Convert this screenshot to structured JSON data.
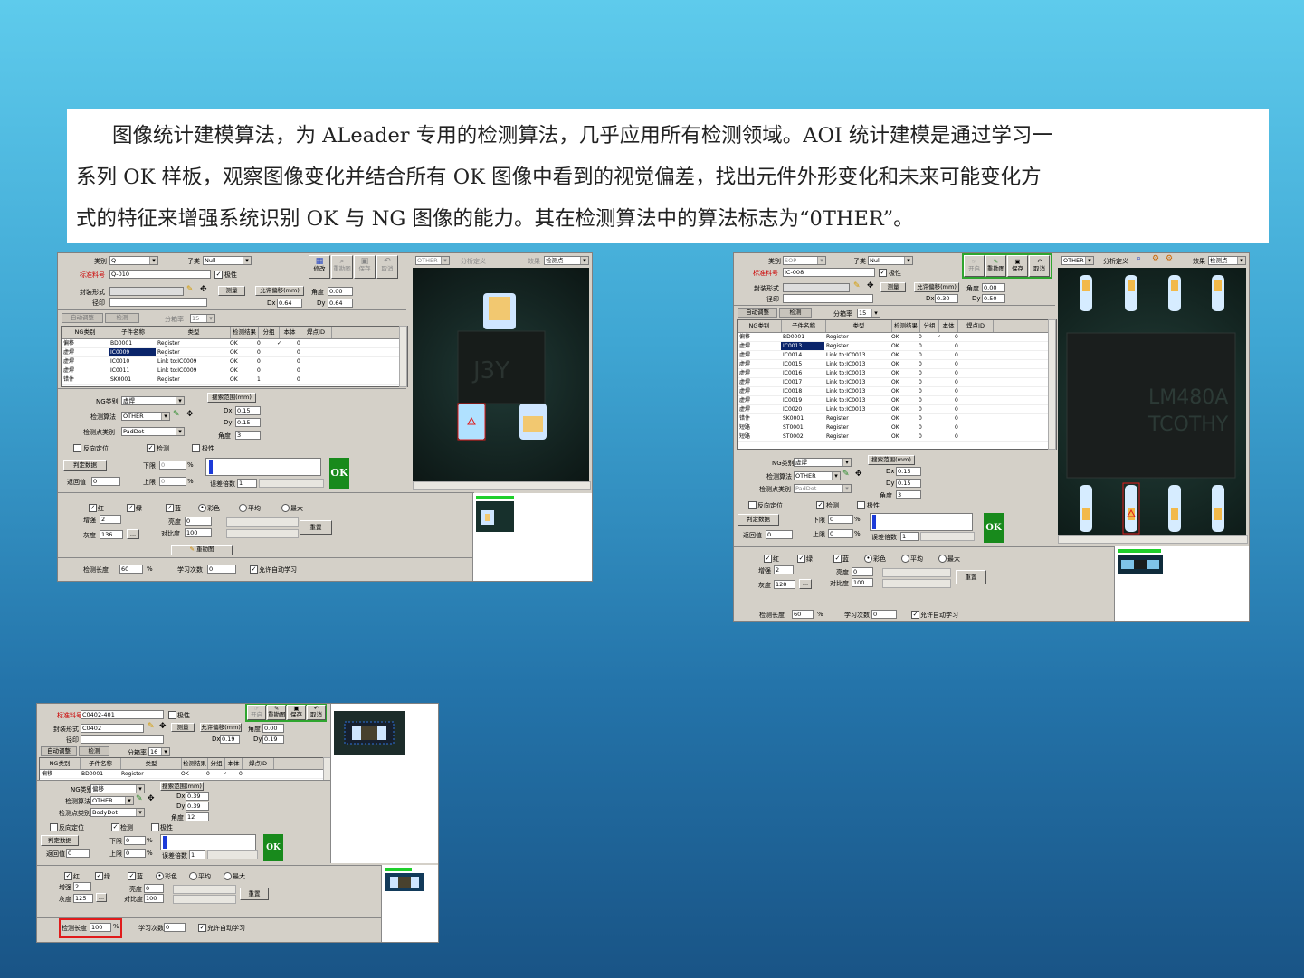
{
  "intro": {
    "line1": "图像统计建模算法，为 ALeader 专用的检测算法，几乎应用所有检测领域。AOI 统计建模是通过学习一",
    "line2": "系列 OK 样板，观察图像变化并结合所有 OK 图像中看到的视觉偏差，找出元件外形变化和未来可能变化方",
    "line3": "式的特征来增强系统识别 OK 与 NG 图像的能力。其在检测算法中的算法标志为“0THER”。"
  },
  "labels": {
    "category": "类别",
    "subcategory": "子类",
    "subcat_value": "Null",
    "std_part": "标准料号",
    "polarity": "极性",
    "package": "封装形式",
    "diameter": "径印",
    "measure": "测量",
    "offset_allowed": "允许偏移(mm)",
    "angle": "角度",
    "dx": "Dx",
    "dy": "Dy",
    "auto_adjust": "自动调整",
    "inspect": "检测",
    "group_num": "分箱率",
    "ng_type": "NG类别",
    "algo": "检测算法",
    "pad_type": "检测点类别",
    "search_range": "搜索范围(mm)",
    "reverse_pos": "反向定位",
    "judge_data": "判定数据",
    "lower": "下限",
    "upper": "上限",
    "return_val": "返回值",
    "err_mult": "误差倍数",
    "ok": "OK",
    "red": "红",
    "green": "绿",
    "blue": "蓝",
    "color": "彩色",
    "average": "平均",
    "max": "最大",
    "gain": "增强",
    "gray": "灰度",
    "brightness": "亮度",
    "contrast": "对比度",
    "reset": "重置",
    "redraw": "重勘图",
    "inspect_len": "检测长度",
    "learn_count": "学习次数",
    "auto_learn": "允许自动学习",
    "modify": "修改",
    "save": "保存",
    "cancel": "取消",
    "start": "开启",
    "analysis_def": "分析定义",
    "effect": "效果",
    "inspect_point": "检测点",
    "pct": "%",
    "dots": "...",
    "other": "OTHER",
    "null_bar": "Null"
  },
  "panel1": {
    "category_val": "Q",
    "part_no": "Q-010",
    "dx": "0.64",
    "dy": "0.64",
    "angle": "0.00",
    "group": "15",
    "columns": [
      "NG类别",
      "子件名称",
      "类型",
      "检测结果",
      "分组",
      "本体",
      "焊点ID"
    ],
    "rows": [
      [
        "偏移",
        "BD0001",
        "Register",
        "OK",
        "0",
        "✓",
        "0"
      ],
      [
        "虚焊",
        "IC0009",
        "Register",
        "OK",
        "0",
        "",
        "0"
      ],
      [
        "虚焊",
        "IC0010",
        "Link to:IC0009",
        "OK",
        "0",
        "",
        "0"
      ],
      [
        "虚焊",
        "IC0011",
        "Link to:IC0009",
        "OK",
        "0",
        "",
        "0"
      ],
      [
        "错件",
        "SK0001",
        "Register",
        "OK",
        "1",
        "",
        "0"
      ]
    ],
    "ng_val": "虚焊",
    "pad_val": "PadDot",
    "search_dx": "0.15",
    "search_dy": "0.15",
    "search_angle": "3",
    "lower": "0",
    "upper": "0",
    "return_val": "0",
    "err_mult": "1",
    "gain": "2",
    "gray": "136",
    "brightness": "0",
    "contrast": "100",
    "len": "60",
    "learn": "0"
  },
  "panel2": {
    "category_val": "SOP",
    "part_no": "IC-008",
    "dx": "0.30",
    "dy": "0.50",
    "angle": "0.00",
    "group": "15",
    "rows": [
      [
        "偏移",
        "BD0001",
        "Register",
        "OK",
        "0",
        "✓",
        "0"
      ],
      [
        "虚焊",
        "IC0013",
        "Register",
        "OK",
        "0",
        "",
        "0"
      ],
      [
        "虚焊",
        "IC0014",
        "Link to:IC0013",
        "OK",
        "0",
        "",
        "0"
      ],
      [
        "虚焊",
        "IC0015",
        "Link to:IC0013",
        "OK",
        "0",
        "",
        "0"
      ],
      [
        "虚焊",
        "IC0016",
        "Link to:IC0013",
        "OK",
        "0",
        "",
        "0"
      ],
      [
        "虚焊",
        "IC0017",
        "Link to:IC0013",
        "OK",
        "0",
        "",
        "0"
      ],
      [
        "虚焊",
        "IC0018",
        "Link to:IC0013",
        "OK",
        "0",
        "",
        "0"
      ],
      [
        "虚焊",
        "IC0019",
        "Link to:IC0013",
        "OK",
        "0",
        "",
        "0"
      ],
      [
        "虚焊",
        "IC0020",
        "Link to:IC0013",
        "OK",
        "0",
        "",
        "0"
      ],
      [
        "错件",
        "SK0001",
        "Register",
        "OK",
        "0",
        "",
        "0"
      ],
      [
        "短路",
        "ST0001",
        "Register",
        "OK",
        "0",
        "",
        "0"
      ],
      [
        "短路",
        "ST0002",
        "Register",
        "OK",
        "0",
        "",
        "0"
      ]
    ],
    "ng_val": "虚焊",
    "pad_val": "PadDot",
    "search_dx": "0.15",
    "search_dy": "0.15",
    "search_angle": "3",
    "lower": "0",
    "upper": "0",
    "return_val": "0",
    "err_mult": "1",
    "gain": "2",
    "gray": "128",
    "brightness": "0",
    "contrast": "100",
    "len": "60",
    "learn": "0"
  },
  "panel3": {
    "part_no": "C0402-401",
    "package": "C0402",
    "dx": "0.19",
    "dy": "0.19",
    "angle": "0.00",
    "group": "16",
    "rows": [
      [
        "偏移",
        "BD0001",
        "Register",
        "OK",
        "0",
        "✓",
        "0"
      ]
    ],
    "ng_val": "偏移",
    "pad_val": "BodyDot",
    "search_dx": "0.39",
    "search_dy": "0.39",
    "search_angle": "12",
    "lower": "0",
    "upper": "0",
    "return_val": "0",
    "err_mult": "1",
    "gain": "2",
    "gray": "125",
    "brightness": "0",
    "contrast": "100",
    "len": "100",
    "learn": "0"
  },
  "colors": {
    "ok_green": "#188a1c",
    "highlight_red": "#e01b1b",
    "selection_blue": "#0a246a"
  }
}
